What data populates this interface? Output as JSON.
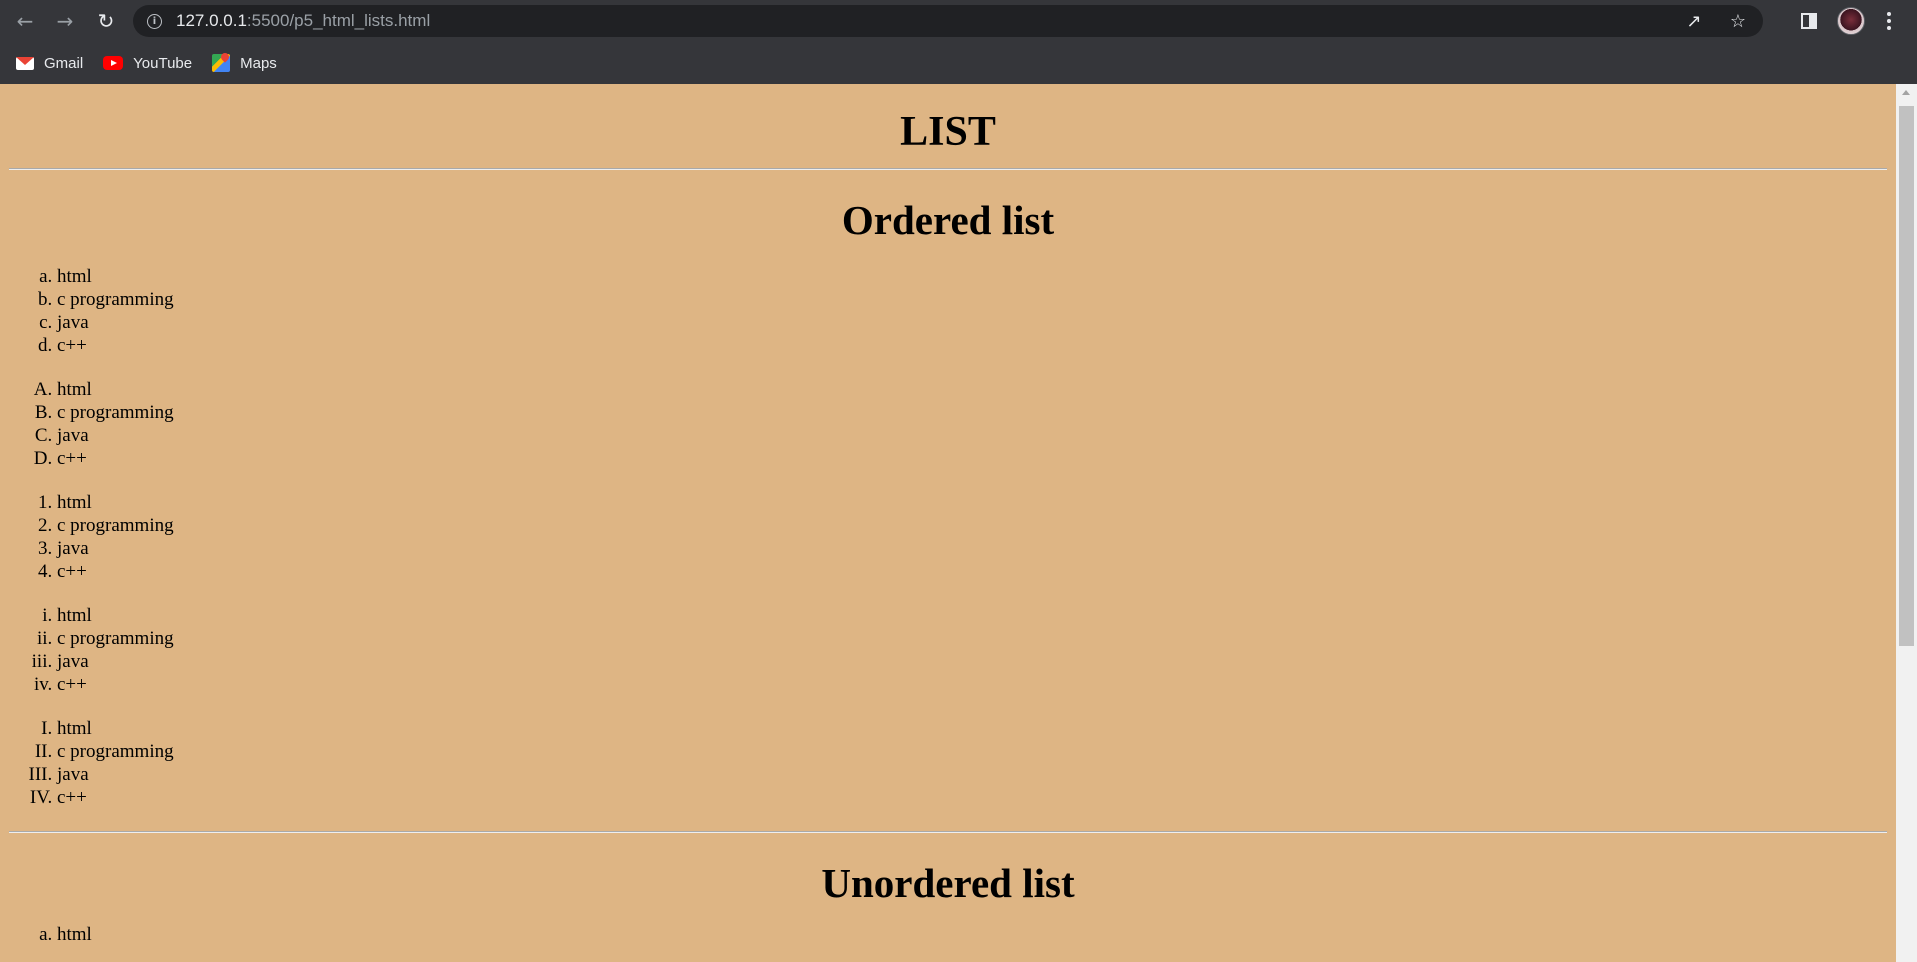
{
  "browser": {
    "url_host": "127.0.0.1",
    "url_rest": ":5500/p5_html_lists.html",
    "bookmarks": [
      {
        "label": "Gmail",
        "icon": "gmail-icon"
      },
      {
        "label": "YouTube",
        "icon": "youtube-icon"
      },
      {
        "label": "Maps",
        "icon": "maps-icon"
      }
    ]
  },
  "page": {
    "background": "#deb584",
    "title": "LIST",
    "ordered_heading": "Ordered list",
    "unordered_heading": "Unordered list",
    "ordered_lists": [
      {
        "type": "a",
        "items": [
          "html",
          "c programming",
          "java",
          "c++"
        ]
      },
      {
        "type": "A",
        "items": [
          "html",
          "c programming",
          "java",
          "c++"
        ]
      },
      {
        "type": "1",
        "items": [
          "html",
          "c programming",
          "java",
          "c++"
        ]
      },
      {
        "type": "i",
        "items": [
          "html",
          "c programming",
          "java",
          "c++"
        ]
      },
      {
        "type": "I",
        "items": [
          "html",
          "c programming",
          "java",
          "c++"
        ]
      }
    ],
    "unordered_first_item": "html"
  }
}
